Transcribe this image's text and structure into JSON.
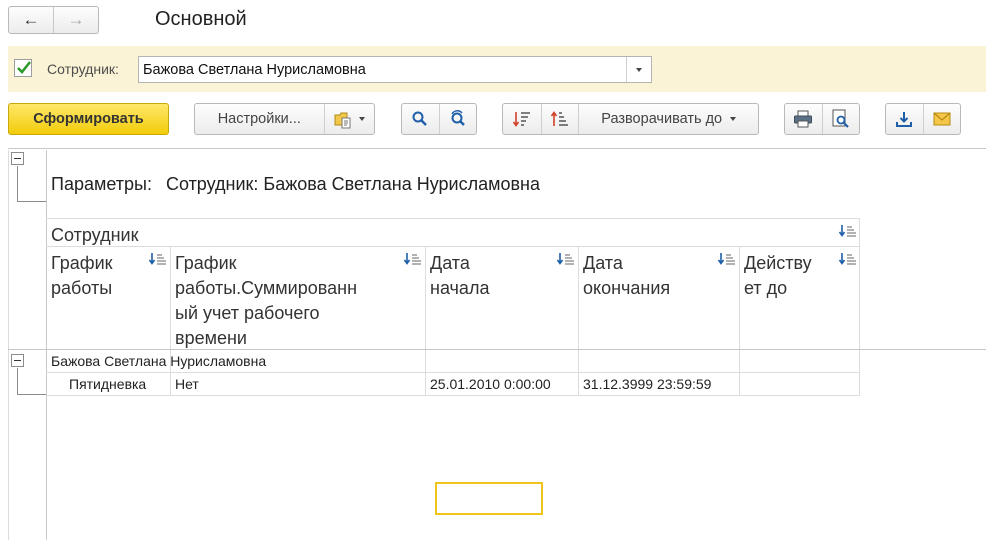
{
  "nav": {
    "back_glyph": "←",
    "forward_glyph": "→"
  },
  "page_title": "Основной",
  "filter": {
    "checked": true,
    "label": "Сотрудник:",
    "value": "Бажова Светлана Нурисламовна"
  },
  "toolbar": {
    "generate_label": "Сформировать",
    "settings_label": "Настройки...",
    "expand_label": "Разворачивать до",
    "icons": [
      "variants-icon",
      "search-icon",
      "search-next-icon",
      "sort-descending-icon",
      "sort-ascending-icon",
      "print-icon",
      "print-preview-icon",
      "save-icon",
      "email-icon"
    ]
  },
  "report": {
    "params_key": "Параметры:",
    "params_value": "Сотрудник: Бажова Светлана Нурисламовна",
    "group_header": "Сотрудник",
    "columns": [
      "График работы",
      "График работы.Суммированный учет рабочего времени",
      "Дата начала",
      "Дата окончания",
      "Действует до"
    ],
    "column_lines": [
      [
        "График",
        "работы"
      ],
      [
        "График",
        "работы.Суммированн",
        "ый учет рабочего",
        "времени"
      ],
      [
        "Дата",
        "начала"
      ],
      [
        "Дата",
        "окончания"
      ],
      [
        "Действу",
        "ет до"
      ]
    ],
    "group_row": "Бажова Светлана Нурисламовна",
    "rows": [
      {
        "schedule": "Пятидневка",
        "summarized": "Нет",
        "start": "25.01.2010 0:00:00",
        "end": "31.12.3999 23:59:59",
        "valid_until": ""
      }
    ]
  },
  "colors": {
    "accent_yellow": "#f2cc0a",
    "filter_bg": "#fbf3d6",
    "check_green": "#2e9a2e",
    "icon_blue": "#1f5fa8",
    "focus": "#f0c419"
  }
}
